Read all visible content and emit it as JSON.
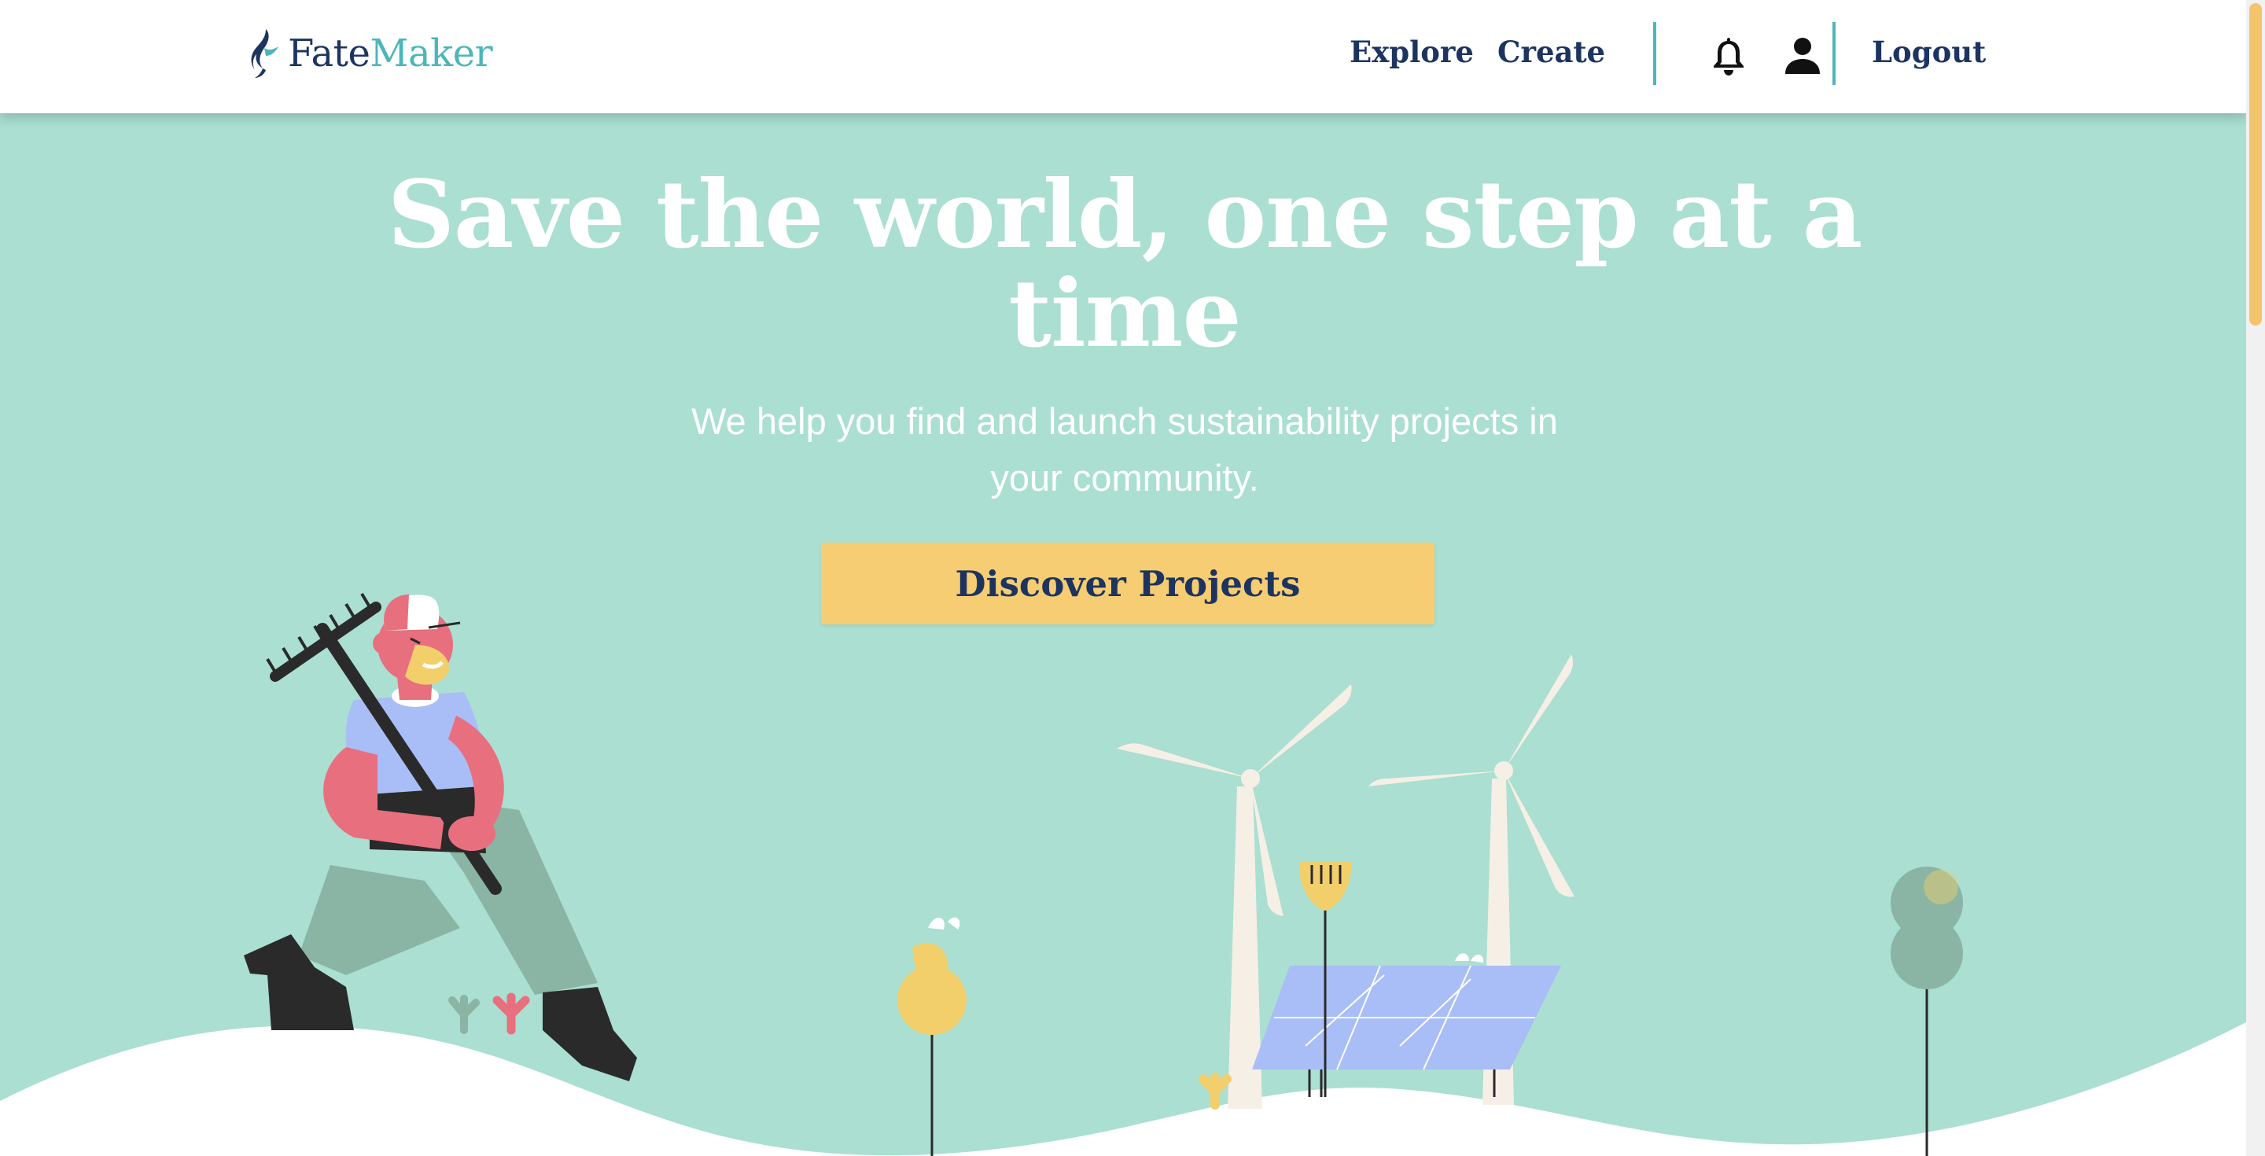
{
  "brand": {
    "name_part1": "Fate",
    "name_part2": "Maker"
  },
  "nav": {
    "explore": "Explore",
    "create": "Create",
    "notifications_icon": "bell-icon",
    "profile_icon": "user-icon",
    "logout": "Logout"
  },
  "hero": {
    "title": "Save the world, one step at a time",
    "subtitle": "We help you find and launch sustainability projects in your community.",
    "cta": "Discover Projects"
  },
  "colors": {
    "background": "#aadfd1",
    "navy": "#1d3461",
    "teal": "#4cb6b9",
    "button": "#f6cd72",
    "header": "#ffffff"
  }
}
